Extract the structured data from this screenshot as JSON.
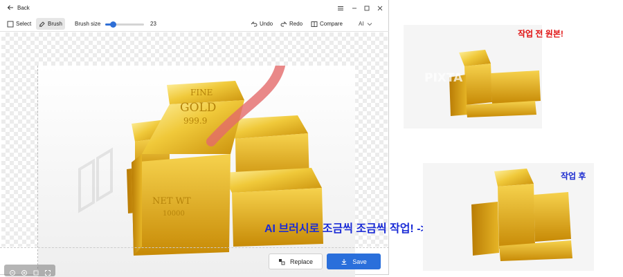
{
  "titlebar": {
    "back_label": "Back",
    "controls": [
      "menu-icon",
      "minimize-icon",
      "maximize-icon",
      "close-icon"
    ]
  },
  "toolbar": {
    "select_label": "Select",
    "brush_label": "Brush",
    "brush_size_label": "Brush size",
    "brush_size_value": "23",
    "brush_size_fraction": 0.2,
    "undo_label": "Undo",
    "redo_label": "Redo",
    "compare_label": "Compare",
    "ai_label": "AI"
  },
  "canvas": {
    "image": {
      "gold_top_text_1": "FINE",
      "gold_top_text_2": "GOLD",
      "gold_top_text_3": "999.9",
      "gold_front_text_1": "NET WT",
      "gold_front_text_2": "10000"
    },
    "zoom_controls": [
      "zoom-out-icon",
      "zoom-in-icon",
      "fit-icon",
      "fullscreen-icon"
    ]
  },
  "footer": {
    "replace_label": "Replace",
    "save_label": "Save"
  },
  "annotations": {
    "before_label": "작업 전 원본!",
    "after_label": "작업 후",
    "arrow_note": "AI 브러시로 조금씩 조금씩 작업! ->",
    "watermark": "PIXTA",
    "before_label_color": "#e01010",
    "after_label_color": "#1b2bd0"
  },
  "colors": {
    "accent": "#2a6fdb",
    "gold": "#e3b21a",
    "brush_stroke": "#e46a6a"
  }
}
